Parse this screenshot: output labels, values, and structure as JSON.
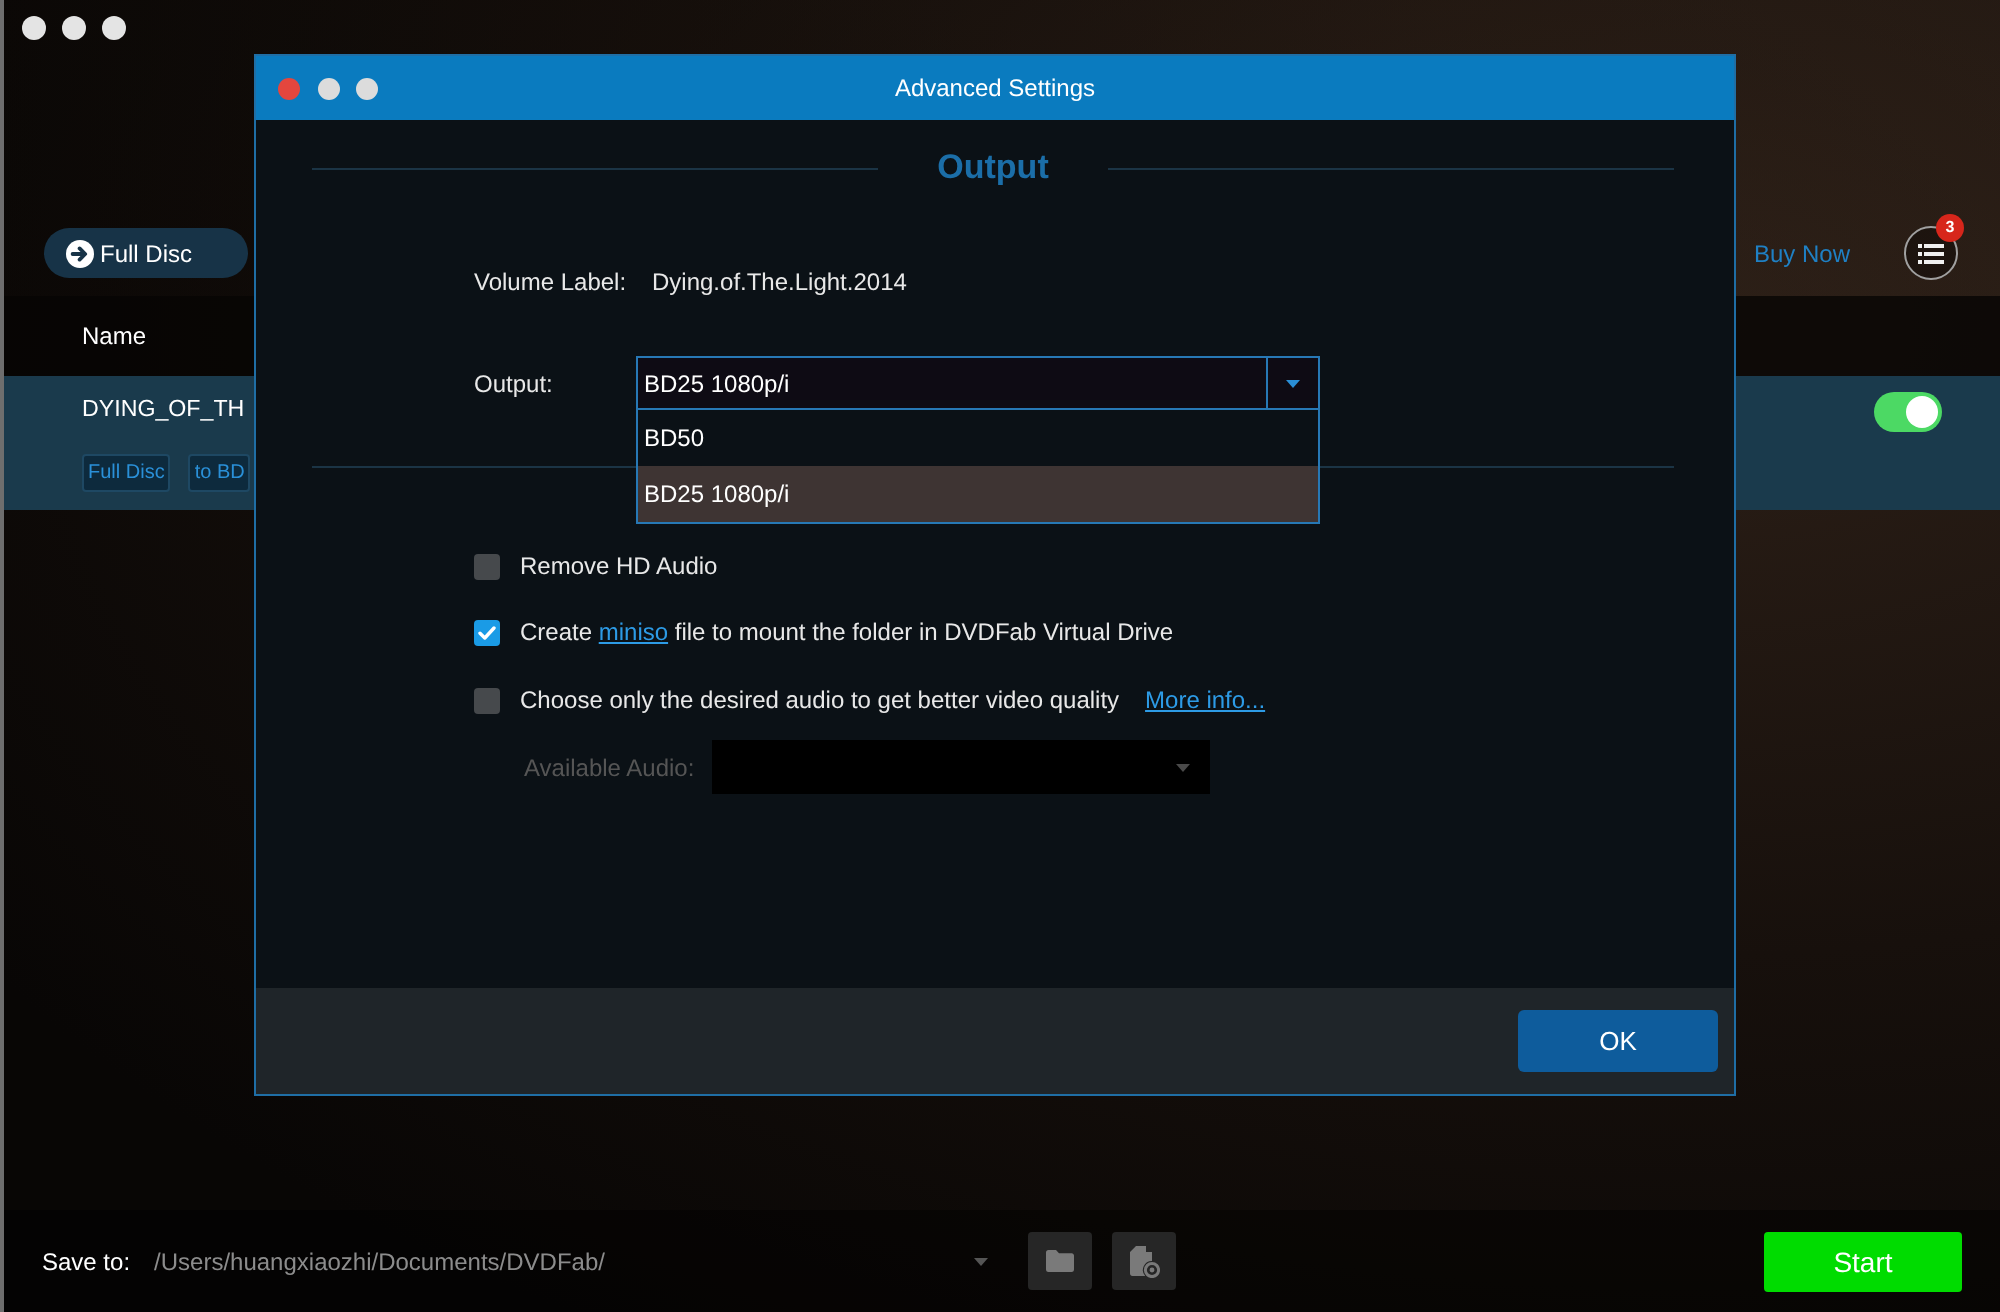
{
  "app": {
    "mode_button": {
      "label": "Full Disc"
    },
    "buy_now": "Buy Now",
    "task_count": "3",
    "list": {
      "columns": [
        "Name"
      ],
      "rows": [
        {
          "name": "DYING_OF_TH",
          "tags": [
            "Full Disc",
            "to BD"
          ],
          "selected": true,
          "on": true
        }
      ]
    },
    "bottom_bar": {
      "label": "Save to:",
      "path": "/Users/huangxiaozhi/Documents/DVDFab/",
      "start": "Start"
    }
  },
  "dialog": {
    "title": "Advanced Settings",
    "heading": "Output",
    "volume": {
      "label": "Volume Label:",
      "value": "Dying.of.The.Light.2014"
    },
    "output": {
      "label": "Output:",
      "value": "BD25 1080p/i",
      "expanded": true,
      "options": [
        {
          "label": "BD50",
          "selected": false
        },
        {
          "label": "BD25 1080p/i",
          "selected": true
        }
      ]
    },
    "checkboxes": [
      {
        "checked": false,
        "segments": [
          {
            "kind": "text",
            "text": "Remove HD Audio"
          }
        ]
      },
      {
        "checked": true,
        "segments": [
          {
            "kind": "text",
            "text": "Create "
          },
          {
            "kind": "link",
            "text": "miniso"
          },
          {
            "kind": "text",
            "text": " file to mount the folder in DVDFab Virtual Drive"
          }
        ]
      },
      {
        "checked": false,
        "segments": [
          {
            "kind": "text",
            "text": "Choose only the desired audio to get better video quality"
          }
        ],
        "link": "More info..."
      }
    ],
    "available_audio": {
      "label": "Available Audio:",
      "disabled": true
    },
    "ok_button": "OK"
  }
}
